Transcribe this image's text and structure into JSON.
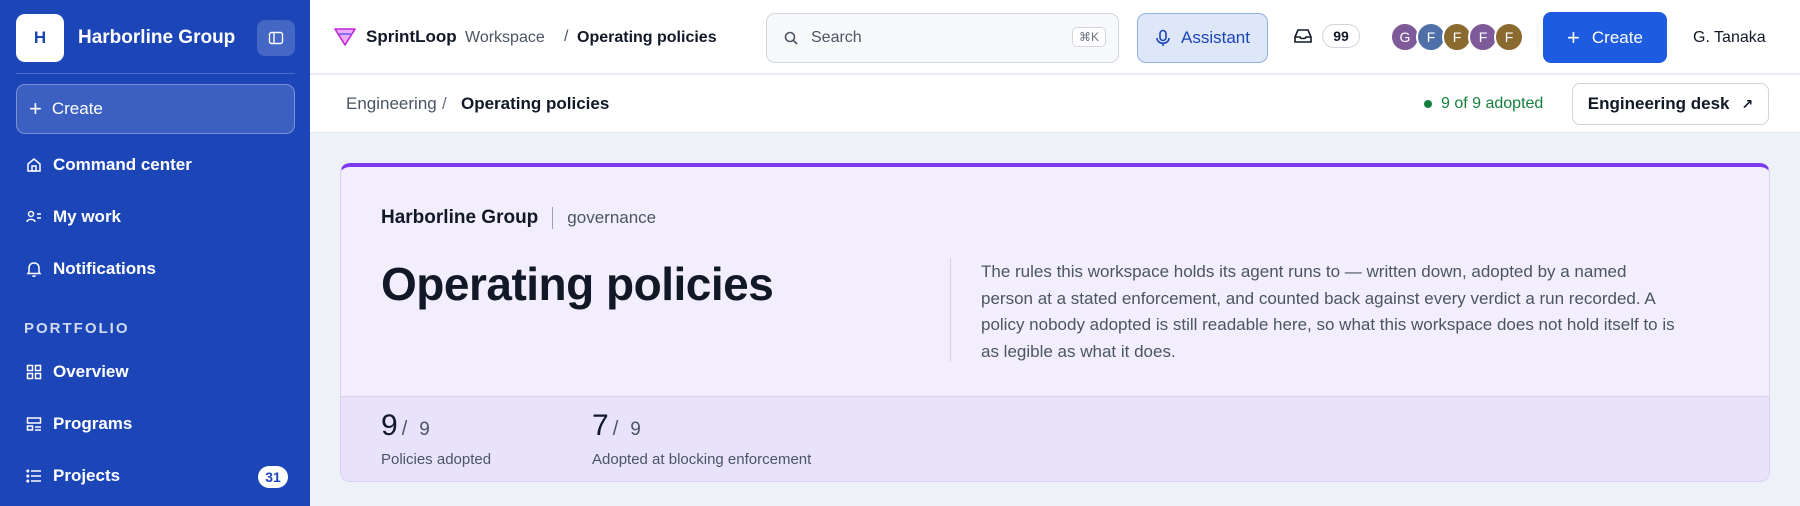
{
  "sidebar": {
    "brand_initial": "H",
    "brand_name": "Harborline Group",
    "create_label": "Create",
    "items": [
      {
        "label": "Command center"
      },
      {
        "label": "My work"
      },
      {
        "label": "Notifications"
      }
    ],
    "section_label": "PORTFOLIO",
    "portfolio_items": [
      {
        "label": "Overview"
      },
      {
        "label": "Programs"
      },
      {
        "label": "Projects",
        "badge": "31"
      }
    ]
  },
  "topbar": {
    "app_name": "SprintLoop",
    "app_sub": "Workspace",
    "separator": "/",
    "crumb": "Operating policies",
    "search_placeholder": "Search",
    "search_shortcut": "⌘K",
    "assistant_label": "Assistant",
    "inbox_count": "99",
    "avatars": [
      {
        "initial": "G",
        "color": "#7e5a9b"
      },
      {
        "initial": "F",
        "color": "#4f6fa8"
      },
      {
        "initial": "F",
        "color": "#8a6a2e"
      },
      {
        "initial": "F",
        "color": "#7e5a9b"
      },
      {
        "initial": "F",
        "color": "#8a6a2e"
      }
    ],
    "create_label": "Create",
    "user_name": "G. Tanaka"
  },
  "subbar": {
    "crumb_parent": "Engineering",
    "crumb_sep": "/",
    "crumb_current": "Operating policies",
    "adopted_status": "9 of 9 adopted",
    "desk_button": "Engineering desk"
  },
  "card": {
    "org_name": "Harborline Group",
    "org_tag": "governance",
    "title": "Operating policies",
    "description": "The rules this workspace holds its agent runs to — written down, adopted by a named person at a stated enforcement, and counted back against every verdict a run recorded. A policy nobody adopted is still readable here, so what this workspace does not hold itself to is as legible as what it does.",
    "stats": [
      {
        "value": "9",
        "slash": "/",
        "total": "9",
        "label": "Policies adopted"
      },
      {
        "value": "7",
        "slash": "/",
        "total": "9",
        "label": "Adopted at blocking enforcement"
      }
    ]
  },
  "colors": {
    "sidebar_bg": "#1c45b8",
    "primary_button": "#1d5ce0",
    "card_accent": "#7c3aed",
    "adopted_green": "#15803d"
  }
}
